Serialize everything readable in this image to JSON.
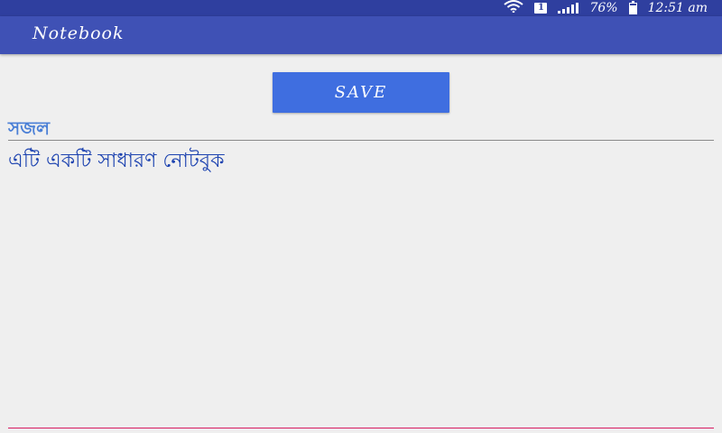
{
  "status_bar": {
    "sim_slot": "1",
    "battery": "76%",
    "battery_level": 0.76,
    "time": "12:51 am",
    "icons": [
      "wifi-icon",
      "sim-icon",
      "signal-icon",
      "battery-icon"
    ]
  },
  "app_bar": {
    "title": "Notebook"
  },
  "toolbar": {
    "save_label": "SAVE"
  },
  "note": {
    "title": "সজল",
    "body": "এটি একটি সাধারণ নোটবুক"
  },
  "colors": {
    "status_bar": "#2f3f9f",
    "app_bar": "#3f51b5",
    "save_button": "#3f6ee0",
    "title_text": "#4a7fd6",
    "body_text": "#1d43b0",
    "body_underline": "#d81b60",
    "background": "#efefef"
  }
}
